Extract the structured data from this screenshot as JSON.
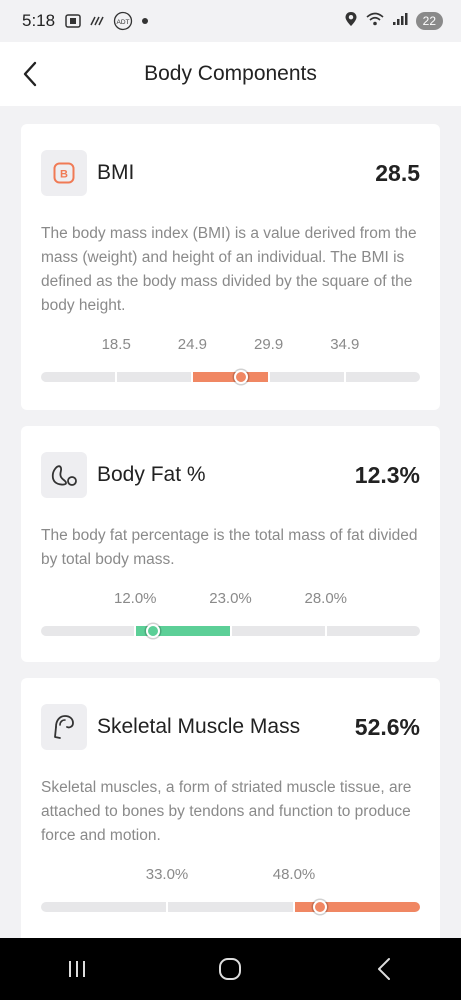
{
  "status_bar": {
    "time": "5:18",
    "notification_icons": [
      "screenshot-icon",
      "dialpad-icon",
      "adt-icon",
      "dot-icon"
    ],
    "right_icons": [
      "location-icon",
      "wifi-icon",
      "signal-icon"
    ],
    "battery_level": "22"
  },
  "header": {
    "title": "Body Components"
  },
  "colors": {
    "high": "#f08763",
    "normal": "#5ccf97",
    "track": "#e7e7e9"
  },
  "cards": [
    {
      "name": "BMI",
      "value": "28.5",
      "icon": "bmi-icon",
      "description": "The body mass index (BMI) is a value derived from the mass (weight) and height of an individual. The BMI is defined as the body mass divided by the square of the body height.",
      "ticks": [
        "18.5",
        "24.9",
        "29.9",
        "34.9"
      ],
      "segment_count": 5,
      "active_segment": 2,
      "active_color": "#f08763",
      "marker_fraction": 0.527
    },
    {
      "name": "Body Fat %",
      "value": "12.3%",
      "icon": "body-fat-icon",
      "description": "The body fat percentage is the total mass of fat divided by total body mass.",
      "ticks": [
        "12.0%",
        "23.0%",
        "28.0%"
      ],
      "segment_count": 4,
      "active_segment": 1,
      "active_color": "#5ccf97",
      "marker_fraction": 0.295
    },
    {
      "name": "Skeletal Muscle Mass",
      "value": "52.6%",
      "icon": "muscle-icon",
      "description": "Skeletal muscles, a form of striated muscle tissue, are attached to bones by tendons and function to produce force and motion.",
      "ticks": [
        "33.0%",
        "48.0%"
      ],
      "segment_count": 3,
      "active_segment": 2,
      "active_color": "#f08763",
      "marker_fraction": 0.735
    }
  ],
  "nav": [
    "recents-icon",
    "home-icon",
    "back-nav-icon"
  ]
}
